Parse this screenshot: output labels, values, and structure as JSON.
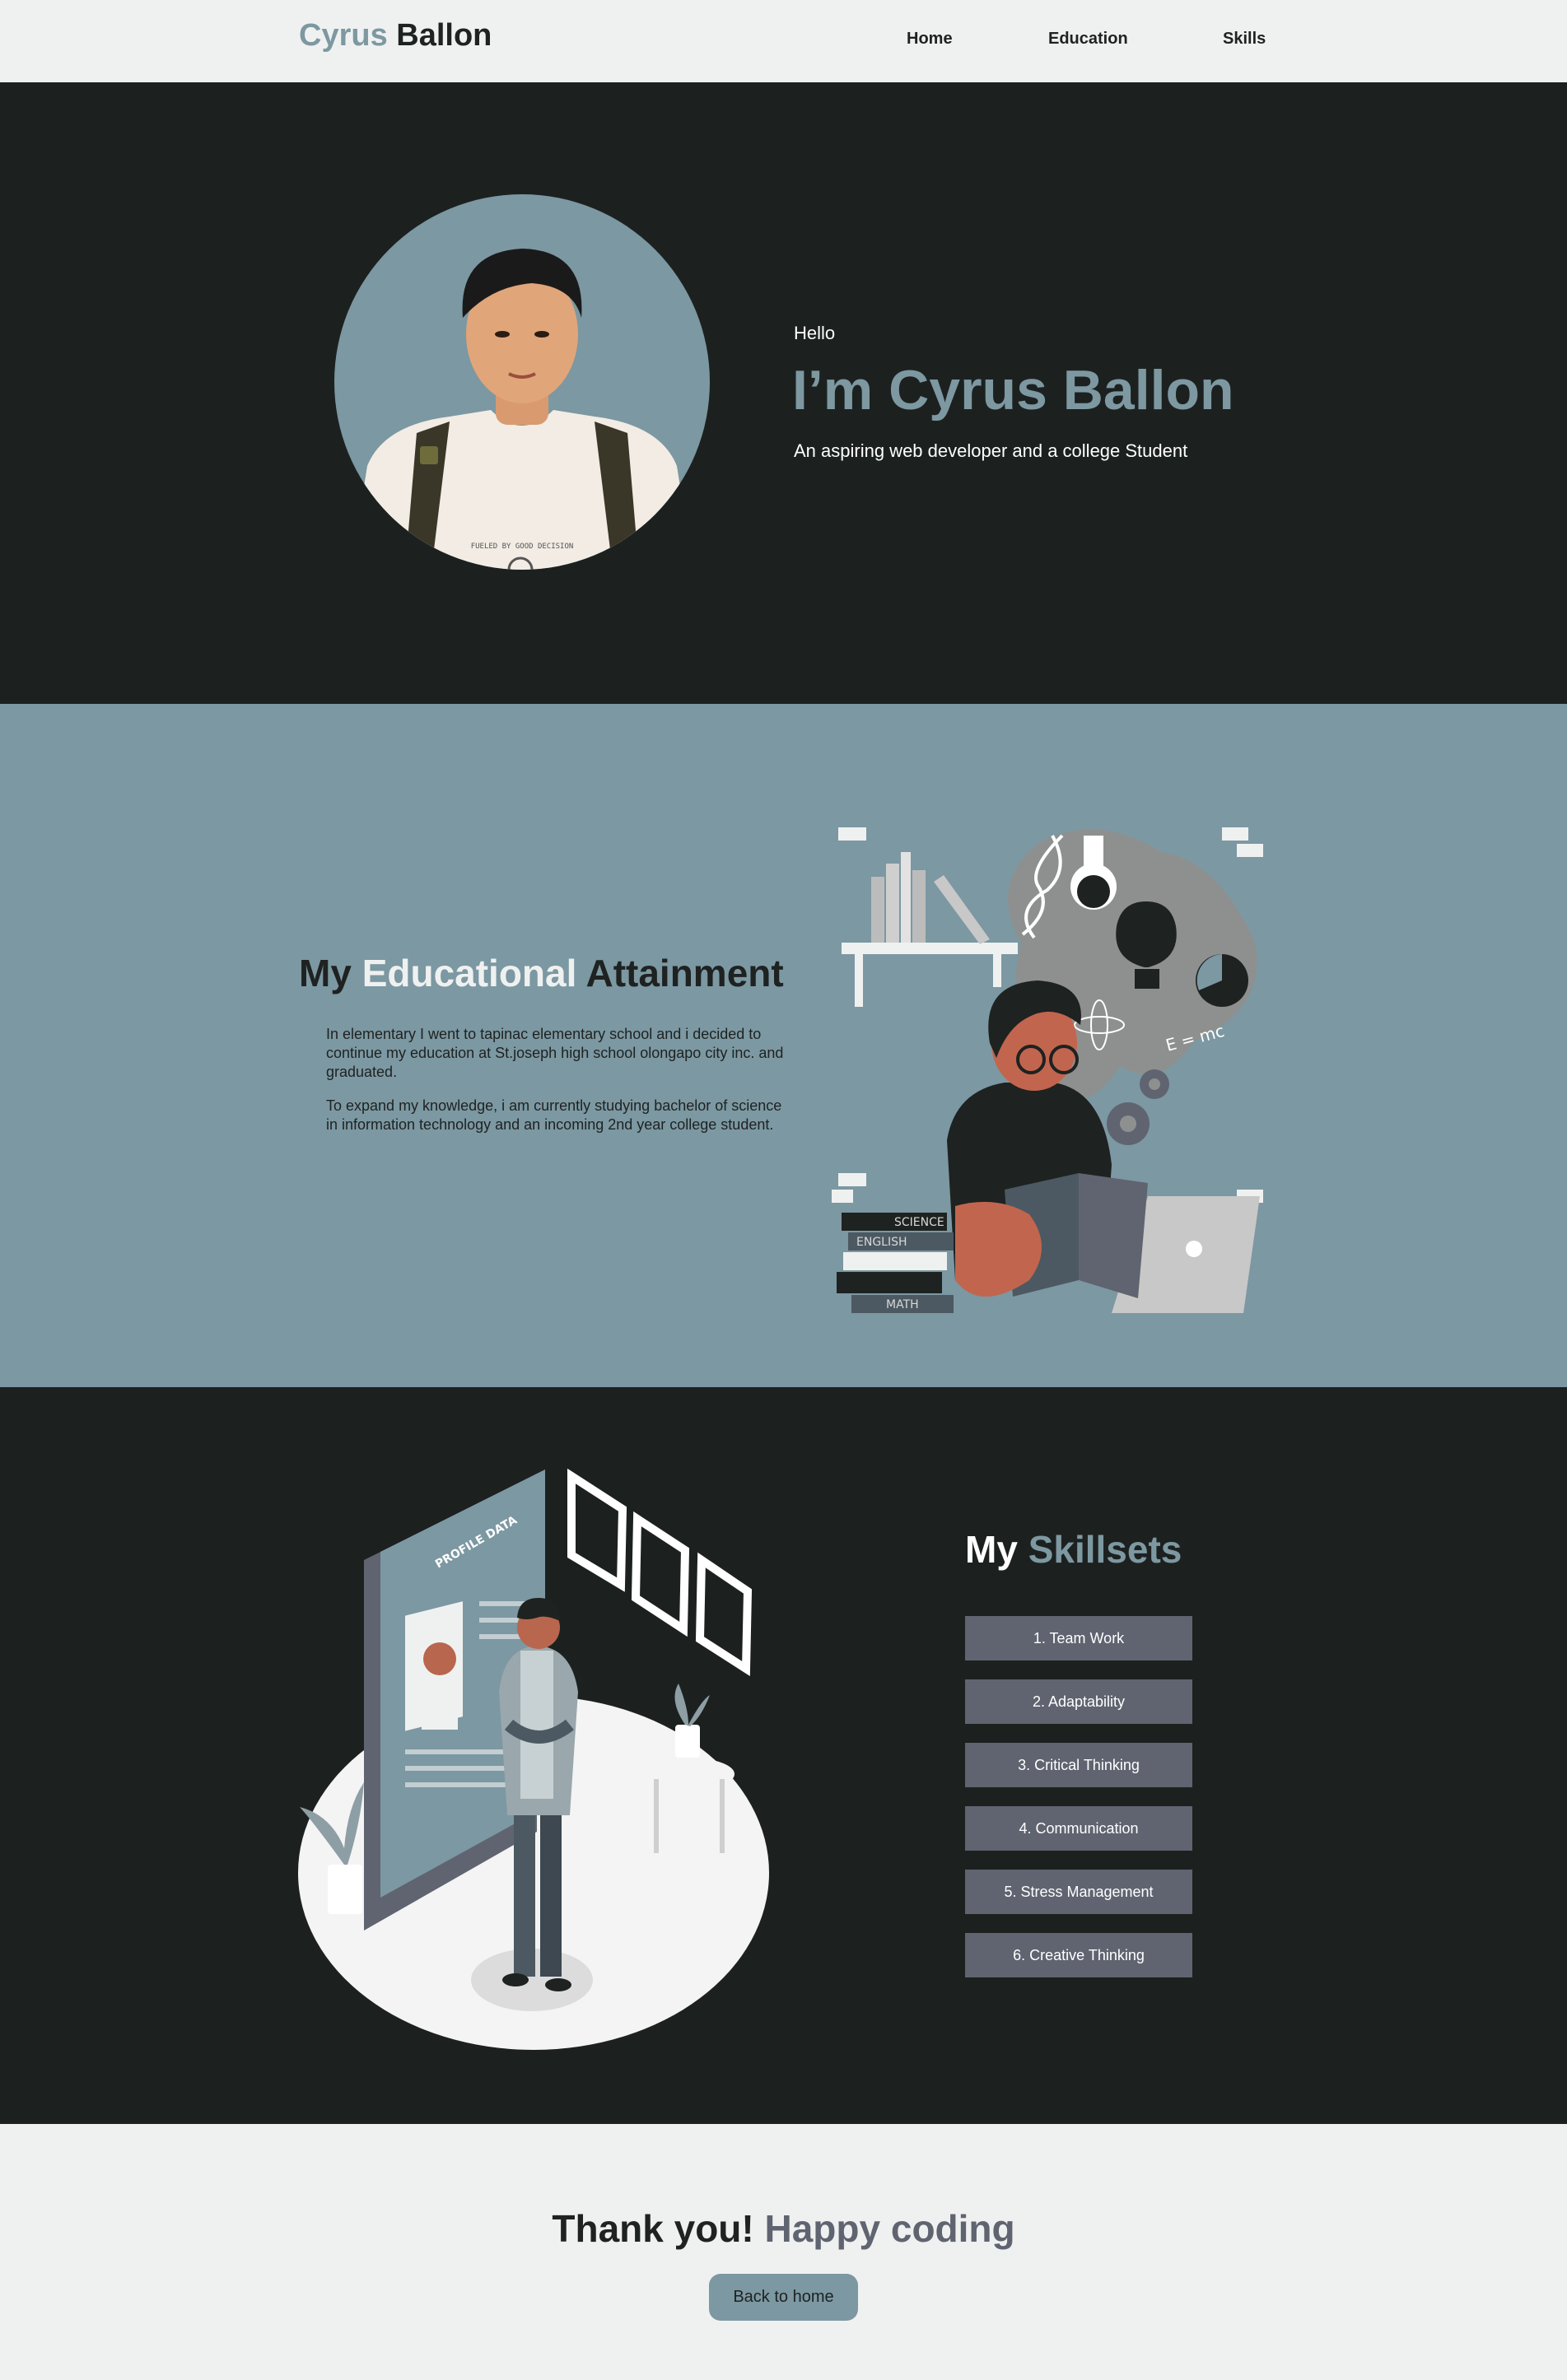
{
  "nav": {
    "logo_first": "Cyrus",
    "logo_last": "Ballon",
    "links": [
      "Home",
      "Education",
      "Skills"
    ]
  },
  "hero": {
    "greeting": "Hello",
    "title": "I’m Cyrus Ballon",
    "subtitle": "An aspiring web developer and a college Student"
  },
  "education": {
    "heading_a": "My",
    "heading_b": "Educational",
    "heading_c": "Attainment",
    "paragraph_1": "In elementary I went to tapinac elementary school and i decided to continue my education at St.joseph high school olongapo city inc. and graduated.",
    "paragraph_2": "To expand my knowledge, i am currently studying bachelor of science in information technology and an incoming 2nd year college student.",
    "illustration_labels": [
      "SCIENCE",
      "ENGLISH",
      "MATH",
      "E = mc"
    ]
  },
  "skills": {
    "heading_a": "My",
    "heading_b": "Skillsets",
    "items": [
      "1. Team Work",
      "2. Adaptability",
      "3. Critical Thinking",
      "4. Communication",
      "5. Stress Management",
      "6. Creative Thinking"
    ],
    "illustration_label": "PROFILE DATA"
  },
  "footer": {
    "heading_a": "Thank you!",
    "heading_b": "Happy coding",
    "button": "Back to home"
  },
  "colors": {
    "dark": "#1c2120",
    "accent": "#7d98a1",
    "light": "#eff1f0",
    "skill_bg": "#5f6470"
  }
}
